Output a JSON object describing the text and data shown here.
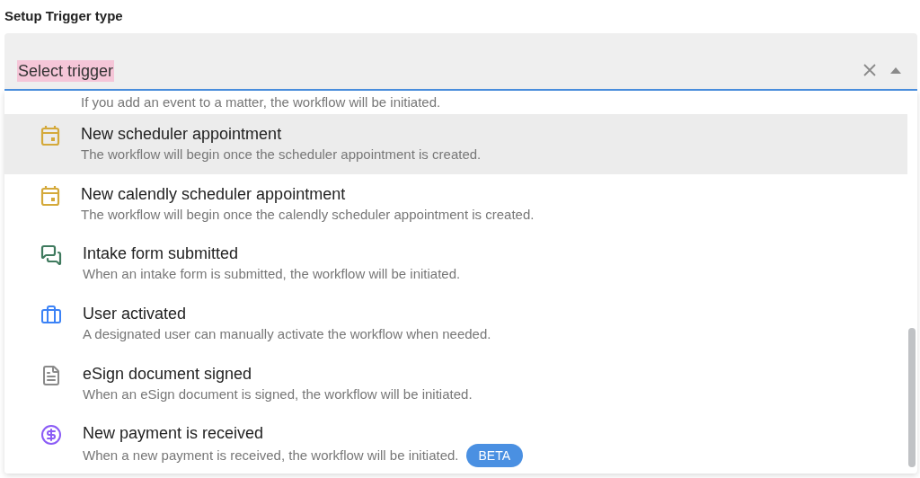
{
  "label": "Setup Trigger type",
  "field": {
    "placeholder": "Select trigger"
  },
  "partial_description": "If you add an event to a matter, the workflow will be initiated.",
  "options": [
    {
      "kind": "calendar",
      "title": "New scheduler appointment",
      "description": "The workflow will begin once the scheduler appointment is created.",
      "selected": true
    },
    {
      "kind": "calendar",
      "title": "New calendly scheduler appointment",
      "description": "The workflow will begin once the calendly scheduler appointment is created.",
      "selected": false
    },
    {
      "kind": "chat",
      "title": "Intake form submitted",
      "description": "When an intake form is submitted, the workflow will be initiated.",
      "selected": false
    },
    {
      "kind": "briefcase",
      "title": "User activated",
      "description": "A designated user can manually activate the workflow when needed.",
      "selected": false
    },
    {
      "kind": "document",
      "title": "eSign document signed",
      "description": "When an eSign document is signed, the workflow will be initiated.",
      "selected": false
    },
    {
      "kind": "dollar",
      "title": "New payment is received",
      "description": "When a new payment is received, the workflow will be initiated.",
      "badge": "BETA",
      "selected": false
    }
  ]
}
